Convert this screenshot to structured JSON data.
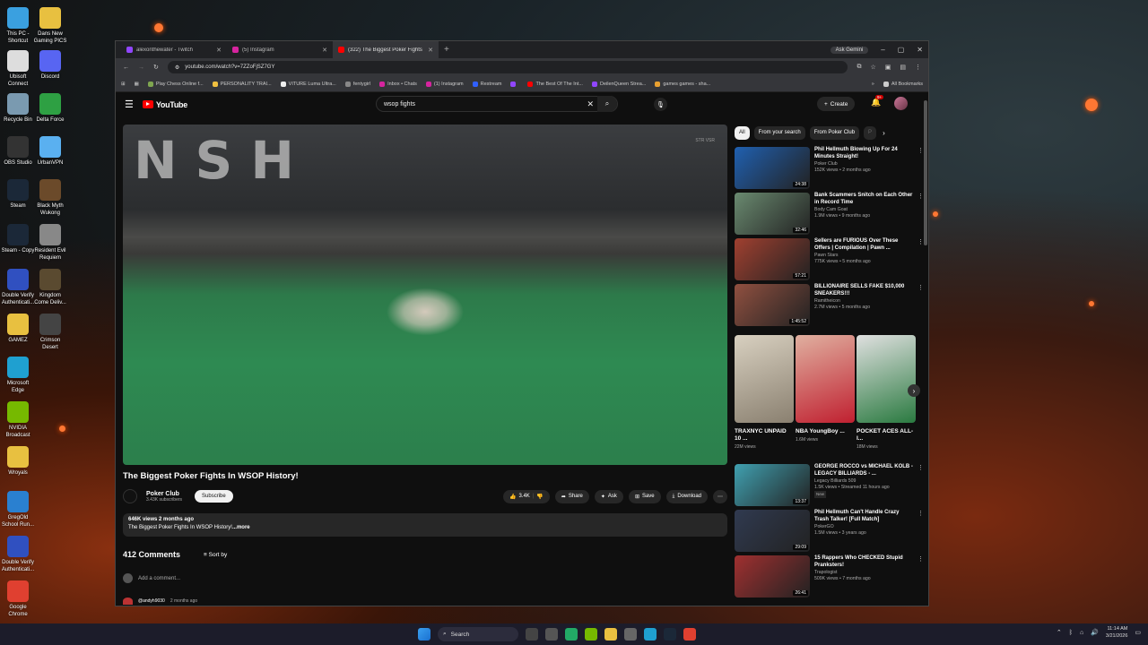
{
  "desktop": {
    "icons": [
      {
        "label": "This PC - Shortcut",
        "color": "#3aa0e0"
      },
      {
        "label": "Dans New Gaming PICS",
        "color": "#e8c040"
      },
      {
        "label": "Ubisoft Connect",
        "color": "#dddddd"
      },
      {
        "label": "Discord",
        "color": "#5865f2"
      },
      {
        "label": "Recycle Bin",
        "color": "#7a9ab0"
      },
      {
        "label": "Delta Force",
        "color": "#2ea043"
      },
      {
        "label": "OBS Studio",
        "color": "#333333"
      },
      {
        "label": "UrbanVPN",
        "color": "#5ab0f0"
      },
      {
        "label": "Steam",
        "color": "#1b2838"
      },
      {
        "label": "Black Myth Wukong",
        "color": "#6b4a2a"
      },
      {
        "label": "Steam - Copy",
        "color": "#1b2838"
      },
      {
        "label": "Resident Evil Requiem",
        "color": "#888888"
      },
      {
        "label": "Double Verify Authenticati...",
        "color": "#3050c0"
      },
      {
        "label": "Kingdom Come Deliv...",
        "color": "#5a4a30"
      },
      {
        "label": "GAMEZ",
        "color": "#e8c040"
      },
      {
        "label": "Crimson Desert",
        "color": "#444444"
      },
      {
        "label": "Microsoft Edge",
        "color": "#1fa0d0"
      },
      {
        "label": "NVIDIA Broadcast",
        "color": "#76b900"
      },
      {
        "label": "Wroyals",
        "color": "#e8c040"
      },
      {
        "label": "GregOld School Run...",
        "color": "#2a80d0"
      },
      {
        "label": "Double Verify Authenticati...",
        "color": "#3050c0"
      },
      {
        "label": "Google Chrome",
        "color": "#e04030"
      }
    ]
  },
  "browser": {
    "tabs": [
      {
        "title": "alexonthewater - Twitch",
        "color": "#9146ff"
      },
      {
        "title": "(5) Instagram",
        "color": "#d6249f"
      },
      {
        "title": "(322) The Biggest Poker Fights",
        "color": "#ff0000"
      }
    ],
    "gemini_label": "Ask Gemini",
    "url": "youtube.com/watch?v=7ZZoFjSZ7GY",
    "bookmarks": [
      {
        "label": "Play Chess Online f...",
        "color": "#7fa650"
      },
      {
        "label": "PERSONALITY TRAI...",
        "color": "#f0c040"
      },
      {
        "label": "VITURE Luma Ultra...",
        "color": "#eeeeee"
      },
      {
        "label": "fentygirl",
        "color": "#888888"
      },
      {
        "label": "Inbox • Chats",
        "color": "#d6249f"
      },
      {
        "label": "(1) Instagram",
        "color": "#d6249f"
      },
      {
        "label": "Restream",
        "color": "#3060ff"
      },
      {
        "label": "",
        "color": "#9146ff"
      },
      {
        "label": "The Best Of The Int...",
        "color": "#ff0000"
      },
      {
        "label": "DeilenQueen Strea...",
        "color": "#9146ff"
      },
      {
        "label": "games games - sha...",
        "color": "#e8a030"
      }
    ],
    "all_bookmarks": "All Bookmarks"
  },
  "youtube": {
    "logo": "YouTube",
    "search_value": "wsop fights",
    "create_label": "Create",
    "notif_count": "9+",
    "player": {
      "lettering": "NSH",
      "watermark": "STR VSR"
    },
    "video_title": "The Biggest Poker Fights In WSOP History!",
    "channel": {
      "name": "Poker Club",
      "subs": "3.43K subscribers"
    },
    "subscribe_label": "Subscribe",
    "actions": {
      "likes": "3.4K",
      "share": "Share",
      "ask": "Ask",
      "save": "Save",
      "download": "Download"
    },
    "description": {
      "meta": "646K views  2 months ago",
      "text": "The Biggest Poker Fights In WSOP History!",
      "more": "...more"
    },
    "comments": {
      "count_label": "412 Comments",
      "sort_label": "Sort by",
      "placeholder": "Add a comment...",
      "first_user": "@andyh9030",
      "first_time": "2 months ago"
    },
    "chips": [
      "All",
      "From your search",
      "From Poker Club",
      "P"
    ],
    "recommended": [
      {
        "title": "Phil Hellmuth Blowing Up For 24 Minutes Straight!",
        "channel": "Poker Club",
        "meta": "152K views • 2 months ago",
        "duration": "24:38",
        "color": "#2060b0"
      },
      {
        "title": "Bank Scammers Snitch on Each Other in Record Time",
        "channel": "Body Cam Goat",
        "meta": "1.9M views • 9 months ago",
        "duration": "32:46",
        "color": "#6a8a70"
      },
      {
        "title": "Sellers are FURIOUS Over These Offers | Compilation | Pawn ...",
        "channel": "Pawn Stars",
        "meta": "775K views • 5 months ago",
        "duration": "57:21",
        "color": "#a04030"
      },
      {
        "title": "BILLIONAIRE SELLS FAKE $10,000 SNEAKERS!!!",
        "channel": "Ramitheicon",
        "meta": "2.7M views • 5 months ago",
        "duration": "1:45:52",
        "color": "#905040"
      }
    ],
    "shorts": [
      {
        "title": "TRAXNYC UNPAID 10 ...",
        "views": "22M views",
        "color": "#b0a890"
      },
      {
        "title": "NBA YoungBoy ...",
        "views": "1.6M views",
        "color": "#c02030"
      },
      {
        "title": "POCKET ACES ALL-I...",
        "views": "18M views",
        "color": "#2a7a40"
      }
    ],
    "recommended2": [
      {
        "title": "GEORGE ROCCO vs MICHAEL KOLB - LEGACY BILLIARDS - ...",
        "channel": "Legacy Billiards 509",
        "meta": "1.5K views • Streamed 11 hours ago",
        "badge": "New",
        "duration": "13:37",
        "color": "#40a0b0"
      },
      {
        "title": "Phil Hellmuth Can't Handle Crazy Trash Talker! [Full Match]",
        "channel": "PokerGO",
        "meta": "1.5M views • 3 years ago",
        "duration": "29:09",
        "color": "#303a50"
      },
      {
        "title": "15 Rappers Who CHECKED Stupid Pranksters!",
        "channel": "Trapologist",
        "meta": "509K views • 7 months ago",
        "duration": "26:41",
        "color": "#a03030"
      }
    ]
  },
  "taskbar": {
    "search": "Search",
    "time": "11:14 AM",
    "date": "3/21/2026"
  }
}
